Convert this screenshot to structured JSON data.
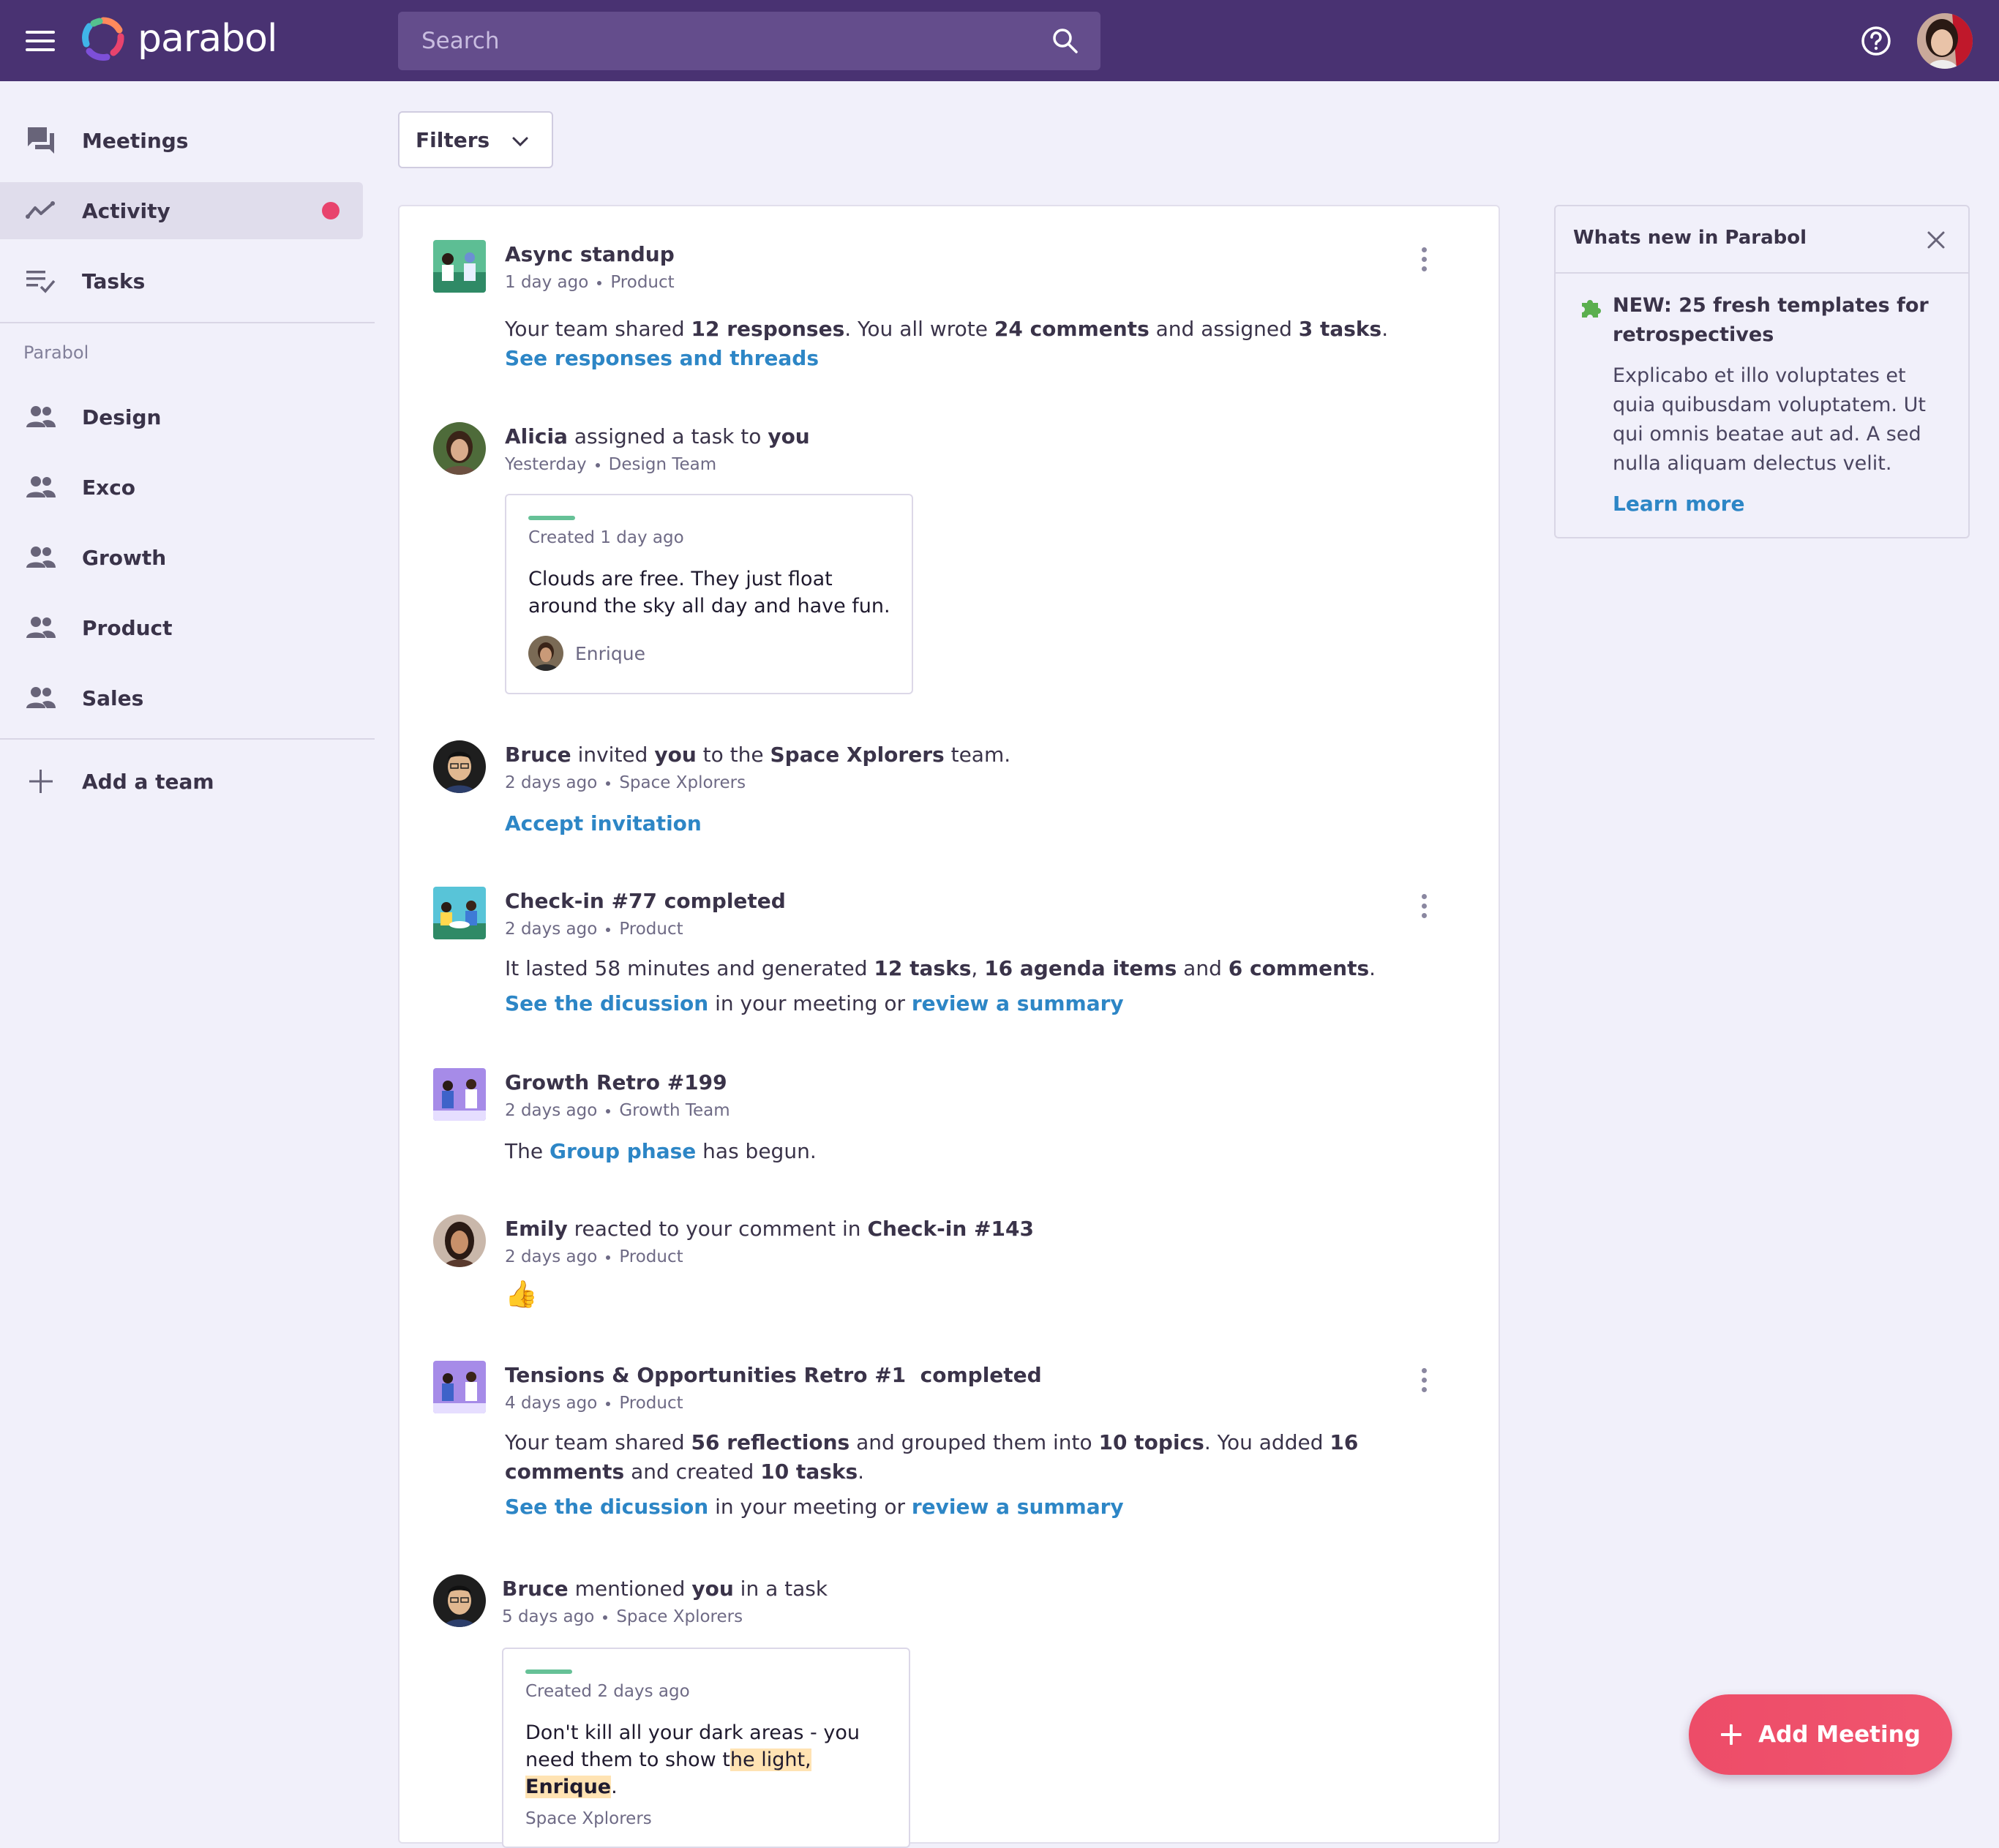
{
  "header": {
    "app_name": "parabol",
    "search_placeholder": "Search"
  },
  "sidebar": {
    "nav": [
      {
        "label": "Meetings",
        "icon": "forum-icon"
      },
      {
        "label": "Activity",
        "icon": "timeline-icon",
        "active": true,
        "has_notification": true
      },
      {
        "label": "Tasks",
        "icon": "playlist-check-icon"
      }
    ],
    "section_label": "Parabol",
    "teams": [
      {
        "label": "Design",
        "icon": "group-icon"
      },
      {
        "label": "Exco",
        "icon": "group-icon"
      },
      {
        "label": "Growth",
        "icon": "group-icon"
      },
      {
        "label": "Product",
        "icon": "group-icon"
      },
      {
        "label": "Sales",
        "icon": "group-icon"
      }
    ],
    "add_team_label": "Add a team"
  },
  "filters": {
    "label": "Filters"
  },
  "feed": {
    "async_standup": {
      "title": "Async standup",
      "time": "1 day ago",
      "team": "Product",
      "text_1": "Your team shared ",
      "responses": "12 responses",
      "text_2": ". You all wrote ",
      "comments": "24 comments",
      "text_3": " and assigned ",
      "tasks": "3 tasks",
      "text_4": ".",
      "link": "See responses and threads"
    },
    "alicia": {
      "actor": "Alicia",
      "action": " assigned a task to ",
      "target": "you",
      "time": "Yesterday",
      "team": "Design Team",
      "card_meta": "Created 1 day ago",
      "card_text": "Clouds are free. They just float around the sky all day and have fun.",
      "card_owner": "Enrique"
    },
    "bruce_invite": {
      "actor": "Bruce",
      "action_1": " invited ",
      "target": "you",
      "action_2": " to the ",
      "team_name": "Space Xplorers",
      "action_3": " team.",
      "time": "2 days ago",
      "team": "Space Xplorers",
      "link": "Accept invitation"
    },
    "checkin": {
      "title": "Check-in #77 completed",
      "time": "2 days ago",
      "team": "Product",
      "text_1": "It lasted 58 minutes and generated ",
      "tasks": "12 tasks",
      "text_2": ", ",
      "agenda": "16 agenda items",
      "text_3": " and ",
      "comments": "6 comments",
      "text_4": ".",
      "link_1": "See the dicussion",
      "text_5": " in your meeting or ",
      "link_2": "review a summary"
    },
    "growth_retro": {
      "title": "Growth Retro #199",
      "time": "2 days ago",
      "team": "Growth Team",
      "text_1": "The ",
      "link": "Group phase",
      "text_2": " has begun."
    },
    "emily": {
      "actor": "Emily",
      "action": " reacted to your comment in ",
      "target": "Check-in #143",
      "time": "2 days ago",
      "team": "Product",
      "reaction": "👍"
    },
    "tensions": {
      "title": "Tensions & Opportunities Retro #1  completed",
      "time": "4 days ago",
      "team": "Product",
      "text_1": "Your team shared ",
      "reflections": "56 reflections",
      "text_2": " and grouped them into ",
      "topics": "10 topics",
      "text_3": ". You added ",
      "comments": "16 comments",
      "text_4": " and created ",
      "tasks": "10 tasks",
      "text_5": ".",
      "link_1": "See the dicussion",
      "text_6": " in your meeting or ",
      "link_2": "review a summary"
    },
    "bruce_mention": {
      "actor": "Bruce",
      "action_1": " mentioned ",
      "target": "you",
      "action_2": " in a task",
      "time": "5 days ago",
      "team": "Space Xplorers",
      "card_meta": "Created 2 days ago",
      "card_text_1": "Don't kill all your dark areas - you need them to show t",
      "card_text_hl_1": "he light, ",
      "card_text_hl_2": "Enrique",
      "card_text_2": ".",
      "card_team": "Space Xplorers"
    }
  },
  "whats_new": {
    "title": "Whats new in Parabol",
    "headline": "NEW: 25 fresh templates for retrospectives",
    "body": "Explicabo et illo voluptates et quia quibusdam voluptatem. Ut qui omnis beatae aut ad. A sed nulla aliquam delectus velit.",
    "link": "Learn more"
  },
  "fab": {
    "label": "Add Meeting"
  },
  "colors": {
    "header": "#493272",
    "accent_link": "#2D86C6",
    "notification": "#E8436D",
    "fab": "#ED4C68",
    "task_bar": "#66C197",
    "background": "#F1F0FA"
  }
}
